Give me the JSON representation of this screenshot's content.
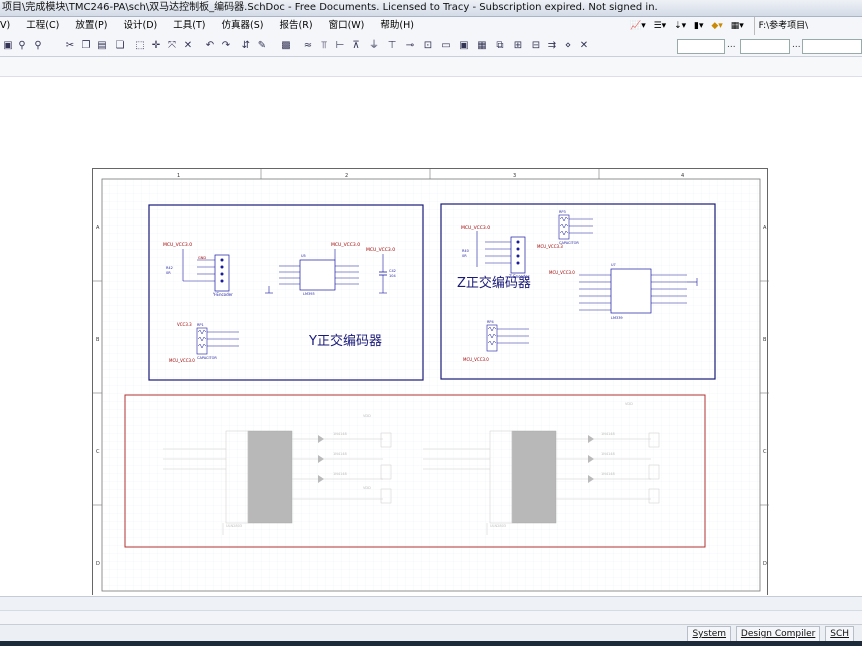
{
  "window": {
    "title": "项目\\完成模块\\TMC246-PA\\sch\\双马达控制板_编码器.SchDoc - Free Documents. Licensed to Tracy - Subscription expired. Not signed in."
  },
  "menu": {
    "items": [
      "V)",
      "工程(C)",
      "放置(P)",
      "设计(D)",
      "工具(T)",
      "仿真器(S)",
      "报告(R)",
      "窗口(W)",
      "帮助(H)"
    ]
  },
  "toolbar_right": {
    "path_label": "F:\\参考项目\\"
  },
  "toolbar2": {
    "dropdown1_value": "",
    "dropdown2_value": "",
    "dropdown3_value": "",
    "dots": "..."
  },
  "sheet": {
    "col_labels": [
      "1",
      "2",
      "3",
      "4"
    ],
    "row_labels": [
      "A",
      "B",
      "C",
      "D"
    ],
    "y_block": {
      "heading": "Y正交编码器",
      "net_vcc": "MCU_VCC3.0",
      "connector_label": "Y-Encoder",
      "ic_label": "LM393",
      "ic_ref": "U5",
      "cap_label": "CAPACITOR",
      "res_ref": "RP1",
      "gnd": "GND",
      "cap_ref": "C42",
      "cap_value": "104",
      "res_ref2": "R42",
      "res_value": "0R"
    },
    "z_block": {
      "heading": "Z正交编码器",
      "net_vcc": "MCU_VCC3.0",
      "connector_label": "Z-Encoder",
      "ic_label": "LM339",
      "ic_ref": "U7",
      "cap_label": "CAPACITOR",
      "res_ref": "RP3",
      "res_ref2": "RP4",
      "res_ref3": "R40",
      "res_value": "0R",
      "net_vcc2": "MCU_VCC3.3"
    },
    "driver_block": {
      "net_vcc": "VDD",
      "ic_label": "ULN2803",
      "diode_label": "1N4148"
    }
  },
  "status": {
    "panels": [
      "System",
      "Design Compiler",
      "SCH"
    ]
  },
  "colors": {
    "block_border": "#1a1a7a",
    "driver_border": "#b03030",
    "wire": "#1a1aa0",
    "net_label": "#a00000"
  }
}
